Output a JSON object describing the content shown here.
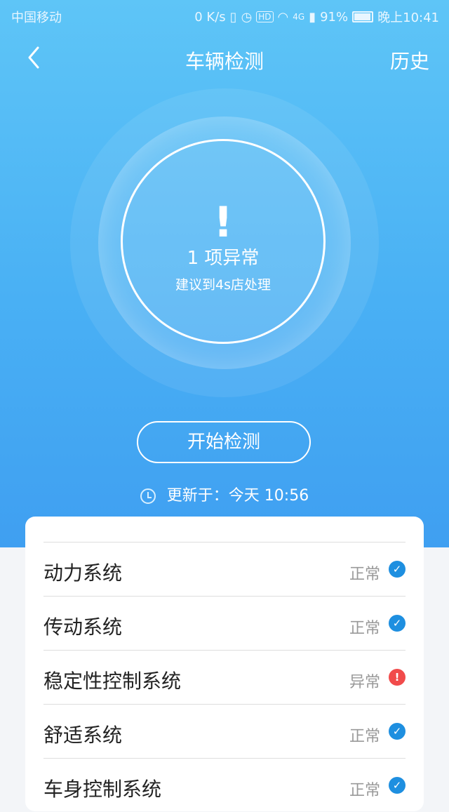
{
  "status_bar": {
    "carrier": "中国移动",
    "speed": "0 K/s",
    "hd": "HD",
    "network": "4G",
    "battery": "91%",
    "time": "晚上10:41"
  },
  "header": {
    "title": "车辆检测",
    "history": "历史"
  },
  "summary": {
    "mark": "!",
    "count_text": "1 项异常",
    "advice": "建议到4s店处理"
  },
  "actions": {
    "start_label": "开始检测"
  },
  "update": {
    "text": "更新于：今天 10:56"
  },
  "systems": [
    {
      "name": "动力系统",
      "status": "正常",
      "ok": true
    },
    {
      "name": "传动系统",
      "status": "正常",
      "ok": true
    },
    {
      "name": "稳定性控制系统",
      "status": "异常",
      "ok": false
    },
    {
      "name": "舒适系统",
      "status": "正常",
      "ok": true
    },
    {
      "name": "车身控制系统",
      "status": "正常",
      "ok": true
    }
  ],
  "colors": {
    "ok": "#1e8fe0",
    "error": "#f14b4b",
    "accent": "#49b0f4"
  }
}
